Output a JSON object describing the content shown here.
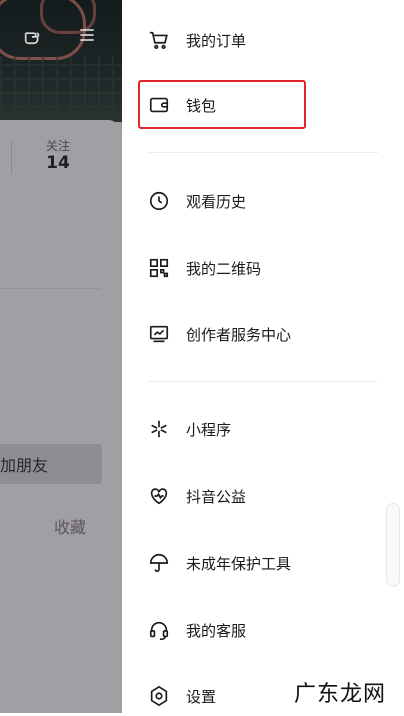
{
  "profile_panel": {
    "follow_label": "关注",
    "follow_count": "14",
    "add_friend_label": "加朋友",
    "favorites_label": "收藏"
  },
  "drawer": {
    "groups": [
      {
        "items": [
          {
            "label": "我的订单",
            "icon": "cart-icon"
          },
          {
            "label": "钱包",
            "icon": "wallet-icon",
            "highlighted": true
          }
        ]
      },
      {
        "items": [
          {
            "label": "观看历史",
            "icon": "clock-icon"
          },
          {
            "label": "我的二维码",
            "icon": "qrcode-icon"
          },
          {
            "label": "创作者服务中心",
            "icon": "monitor-chart-icon"
          }
        ]
      },
      {
        "items": [
          {
            "label": "小程序",
            "icon": "mini-program-icon"
          },
          {
            "label": "抖音公益",
            "icon": "heart-pulse-icon"
          },
          {
            "label": "未成年保护工具",
            "icon": "umbrella-icon"
          },
          {
            "label": "我的客服",
            "icon": "headset-icon"
          },
          {
            "label": "设置",
            "icon": "gear-icon"
          }
        ]
      }
    ]
  },
  "watermark": "广东龙网",
  "colors": {
    "highlight": "#e0262b",
    "overlay": "#9d9aa0"
  }
}
